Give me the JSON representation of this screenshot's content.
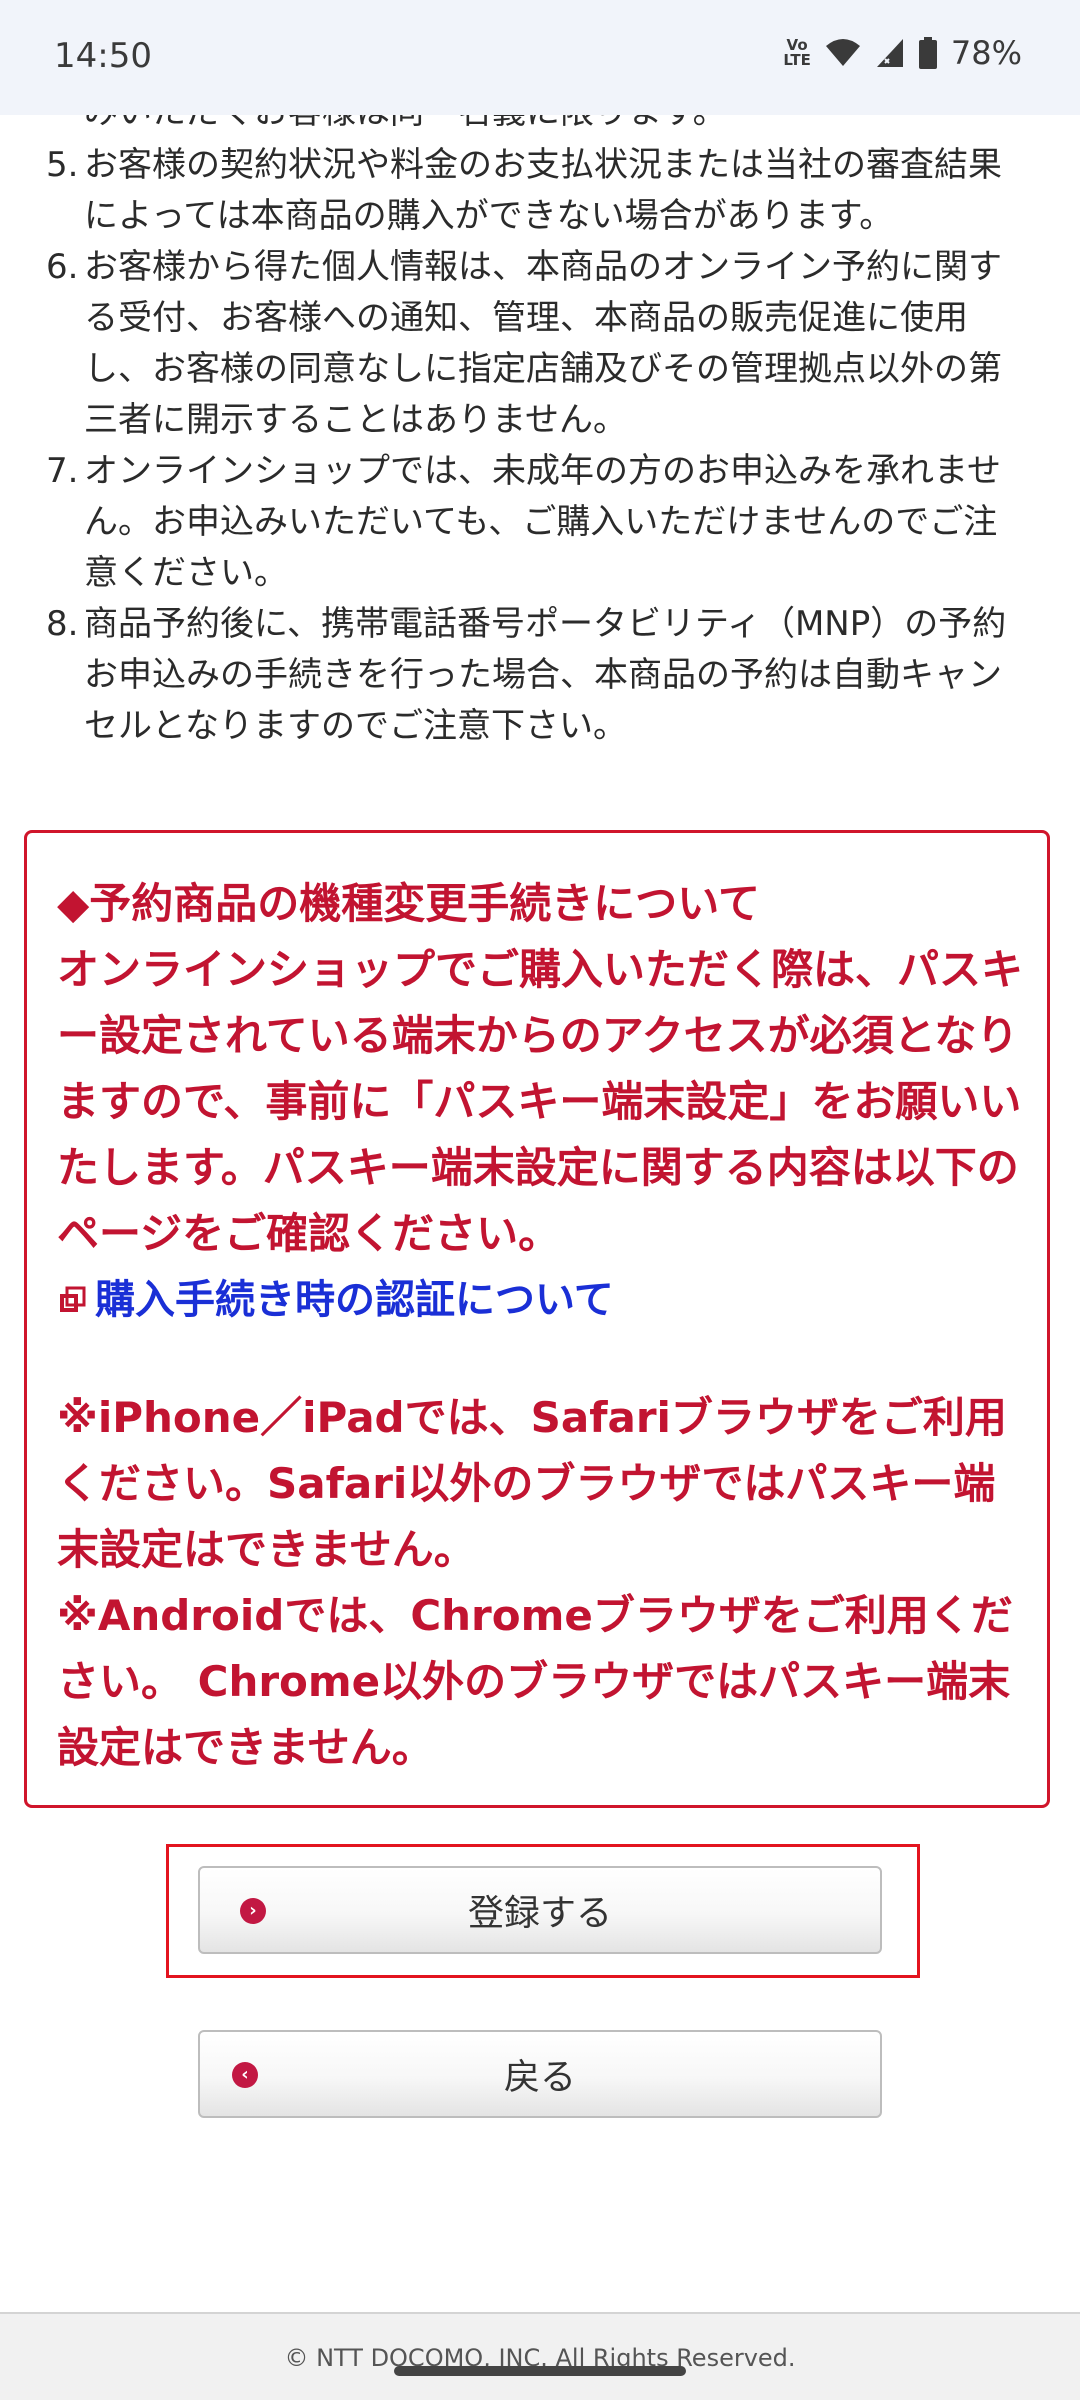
{
  "status_bar": {
    "time": "14:50",
    "volte_label": "Vo\nLTE",
    "battery": "78%"
  },
  "notes": {
    "clipped_line": "みいただくお客様は同一名義に限ります。",
    "items": [
      {
        "num": "5.",
        "text": "お客様の契約状況や料金のお支払状況または当社の審査結果によっては本商品の購入ができない場合があります。"
      },
      {
        "num": "6.",
        "text": "お客様から得た個人情報は、本商品のオンライン予約に関する受付、お客様への通知、管理、本商品の販売促進に使用し、お客様の同意なしに指定店舗及びその管理拠点以外の第三者に開示することはありません。"
      },
      {
        "num": "7.",
        "text": "オンラインショップでは、未成年の方のお申込みを承れません。お申込みいただいても、ご購入いただけませんのでご注意ください。"
      },
      {
        "num": "8.",
        "text": "商品予約後に、携帯電話番号ポータビリティ（MNP）の予約お申込みの手続きを行った場合、本商品の予約は自動キャンセルとなりますのでご注意下さい。"
      }
    ]
  },
  "notice": {
    "heading": "◆予約商品の機種変更手続きについて",
    "body": "オンラインショップでご購入いただく際は、パスキー設定されている端末からのアクセスが必須となりますので、事前に「パスキー端末設定」をお願いいたします。パスキー端末設定に関する内容は以下のページをご確認ください。",
    "link_label": "購入手続き時の認証について",
    "iphone_note": "※iPhone／iPadでは、Safariブラウザをご利用ください。Safari以外のブラウザではパスキー端末設定はできません。",
    "android_note": "※Androidでは、Chromeブラウザをご利用ください。 Chrome以外のブラウザではパスキー端末設定はできません。"
  },
  "buttons": {
    "register_label": "登録する",
    "back_label": "戻る"
  },
  "footer": {
    "copyright": "© NTT DOCOMO, INC. All Rights Reserved."
  },
  "colors": {
    "notice_red": "#c21431",
    "link_blue": "#1a2fd6",
    "frame_red": "#e3141f"
  }
}
